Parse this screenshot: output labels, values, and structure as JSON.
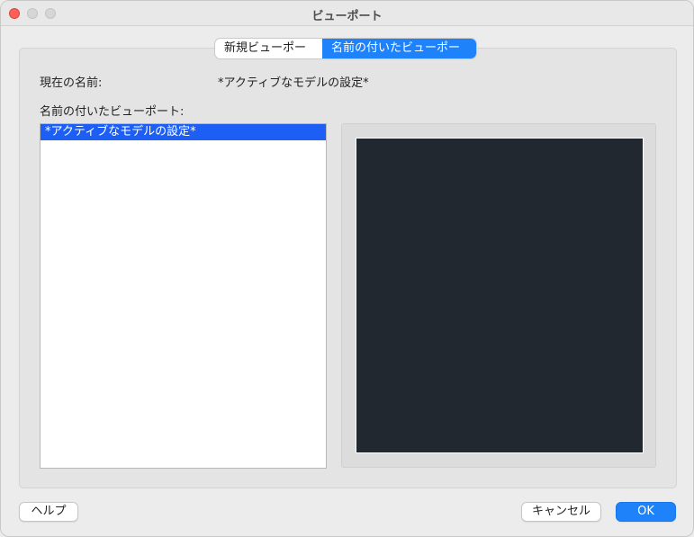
{
  "window": {
    "title": "ビューポート"
  },
  "tabs": [
    {
      "label": "新規ビューポート",
      "selected": false
    },
    {
      "label": "名前の付いたビューポート",
      "selected": true
    }
  ],
  "current_name": {
    "label": "現在の名前:",
    "value": "*アクティブなモデルの設定*"
  },
  "named_viewports": {
    "label": "名前の付いたビューポート:",
    "items": [
      {
        "label": "*アクティブなモデルの設定*",
        "selected": true
      }
    ]
  },
  "preview": {
    "background": "#222830"
  },
  "buttons": {
    "help": "ヘルプ",
    "cancel": "キャンセル",
    "ok": "OK"
  },
  "colors": {
    "accent": "#1e82fb",
    "selection": "#1d5ff5"
  }
}
